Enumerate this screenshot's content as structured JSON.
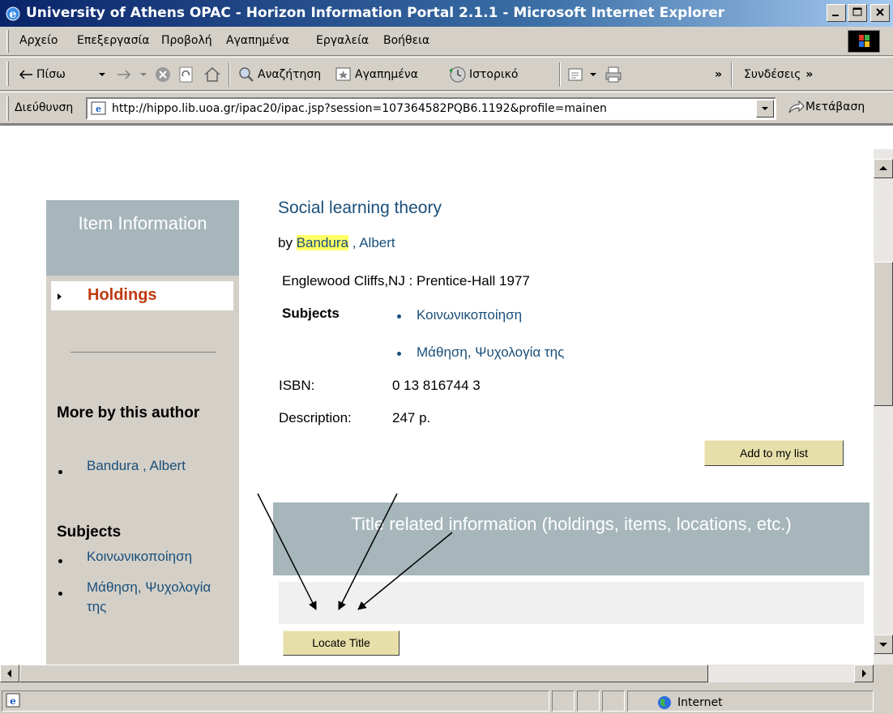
{
  "window": {
    "title": "University of Athens OPAC - Horizon Information Portal 2.1.1 - Microsoft Internet Explorer"
  },
  "menu": [
    "Αρχείο",
    "Επεξεργασία",
    "Προβολή",
    "Αγαπημένα",
    "Εργαλεία",
    "Βοήθεια"
  ],
  "toolbar": {
    "back": "Πίσω",
    "search": "Αναζήτηση",
    "favorites": "Αγαπημένα",
    "history": "Ιστορικό",
    "chevron": "»",
    "links": "Συνδέσεις"
  },
  "address": {
    "label": "Διεύθυνση",
    "url": "http://hippo.lib.uoa.gr/ipac20/ipac.jsp?session=107364582PQB6.1192&profile=mainen",
    "go": "Μετάβαση"
  },
  "sidebar": {
    "header": "Item Information",
    "tab": "Holdings",
    "more_by_heading": "More by this author",
    "author_link": "Bandura , Albert",
    "subjects_heading": "Subjects",
    "subject_links": [
      "Κοινωνικοποίηση",
      "Μάθηση, Ψυχολογία της"
    ]
  },
  "record": {
    "title": "Social learning theory",
    "by": "by",
    "author_highlight": "Bandura",
    "author_rest": " , Albert",
    "publication": "Englewood Cliffs,NJ : Prentice-Hall 1977",
    "subjects_label": "Subjects",
    "subjects": [
      "Κοινωνικοποίηση",
      "Μάθηση, Ψυχολογία της"
    ],
    "isbn_label": "ISBN:",
    "isbn": "0 13 816744 3",
    "description_label": "Description:",
    "description": "247 p.",
    "add_button": "Add to my list"
  },
  "related": {
    "heading": "Title related information (holdings, items, locations, etc.)",
    "locate_button": "Locate Title"
  },
  "status": {
    "zone": "Internet"
  }
}
